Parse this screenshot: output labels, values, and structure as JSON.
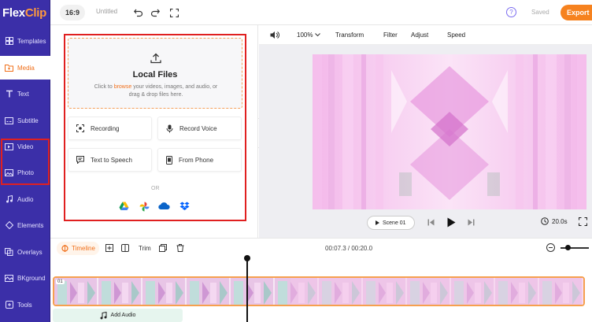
{
  "app": {
    "logo_flex": "Flex",
    "logo_clip": "Clip"
  },
  "sidebar": {
    "items": [
      {
        "label": "Templates",
        "icon": "templates-icon"
      },
      {
        "label": "Media",
        "icon": "media-icon",
        "active": true
      },
      {
        "label": "Text",
        "icon": "text-icon"
      },
      {
        "label": "Subtitle",
        "icon": "subtitle-icon"
      },
      {
        "label": "Video",
        "icon": "video-icon"
      },
      {
        "label": "Photo",
        "icon": "photo-icon"
      },
      {
        "label": "Audio",
        "icon": "audio-icon"
      },
      {
        "label": "Elements",
        "icon": "elements-icon"
      },
      {
        "label": "Overlays",
        "icon": "overlays-icon"
      },
      {
        "label": "BKground",
        "icon": "bkground-icon"
      },
      {
        "label": "Tools",
        "icon": "tools-icon"
      }
    ]
  },
  "topbar": {
    "aspect_ratio": "16:9",
    "project_title": "Untitled",
    "help": "?",
    "saved": "Saved",
    "export": "Export"
  },
  "media": {
    "local_files_title": "Local Files",
    "upload_desc_pre": "Click to ",
    "upload_desc_link": "browse",
    "upload_desc_post": " your videos, images, and audio, or drag & drop files here.",
    "options": {
      "recording": "Recording",
      "record_voice": "Record Voice",
      "text_to_speech": "Text to Speech",
      "from_phone": "From Phone"
    },
    "or": "OR"
  },
  "toolbar": {
    "zoom": "100%",
    "transform": "Transform",
    "filter": "Filter",
    "adjust": "Adjust",
    "speed": "Speed"
  },
  "player": {
    "scene": "Scene 01",
    "duration": "20.0s"
  },
  "timeline": {
    "label": "Timeline",
    "trim": "Trim",
    "time": "00:07.3 / 00:20.0",
    "clip_index": "01",
    "add_audio": "Add Audio"
  },
  "colors": {
    "sidebar_bg": "#3b2fa8",
    "accent": "#f6821f",
    "highlight_box": "#e02020"
  }
}
